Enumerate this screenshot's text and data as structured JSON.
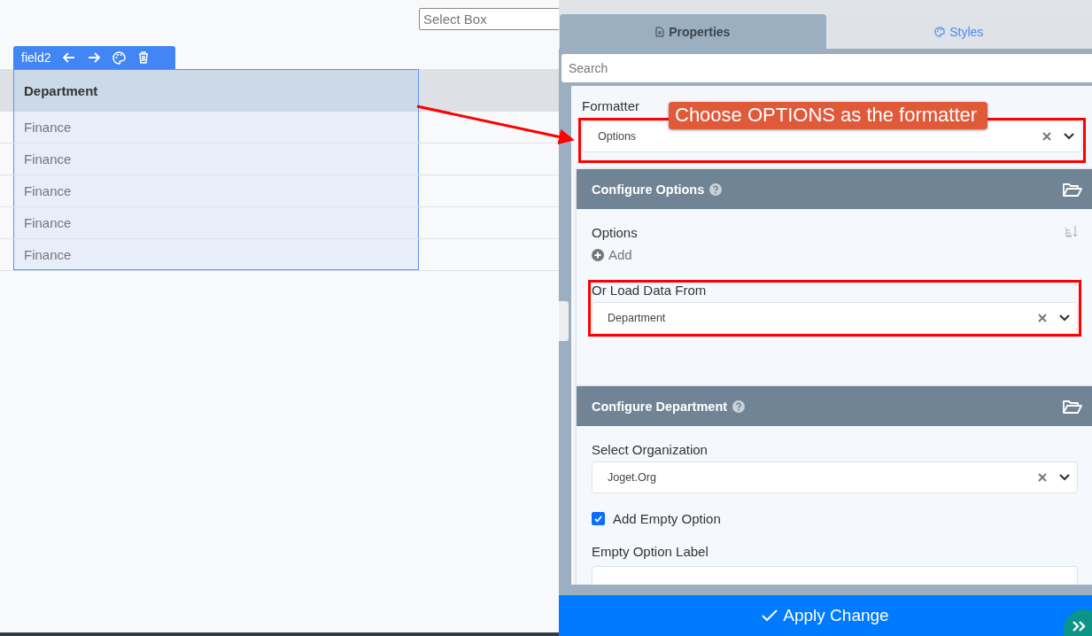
{
  "canvas": {
    "select_box": {
      "placeholder": "Select Box"
    },
    "field_toolbar": {
      "label": "field2"
    },
    "table": {
      "column": "Department",
      "rows": [
        "Finance",
        "Finance",
        "Finance",
        "Finance",
        "Finance"
      ]
    }
  },
  "panel": {
    "tabs": [
      {
        "label": "Properties",
        "selected": true
      },
      {
        "label": "Styles",
        "selected": false
      }
    ],
    "search": {
      "placeholder": "Search"
    },
    "formatter": {
      "label": "Formatter",
      "value": "Options",
      "highlighted": true
    },
    "callout": "Choose OPTIONS as the formatter",
    "sections": [
      {
        "title": "Configure Options",
        "fields": [
          {
            "kind": "options",
            "label": "Options",
            "add": "Add"
          },
          {
            "kind": "select",
            "label": "Or Load Data From",
            "value": "Department",
            "highlighted": true
          }
        ]
      },
      {
        "title": "Configure Department",
        "fields": [
          {
            "kind": "select",
            "label": "Select Organization",
            "value": "Joget.Org"
          },
          {
            "kind": "checkbox",
            "label": "Add Empty Option",
            "checked": true
          },
          {
            "kind": "text",
            "label": "Empty Option Label"
          }
        ]
      }
    ],
    "apply_button": "Apply Change"
  }
}
